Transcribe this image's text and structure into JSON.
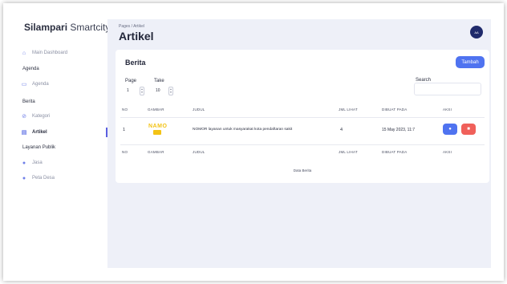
{
  "brand": {
    "bold": "Silampari",
    "light": " Smartcity"
  },
  "sidebar": {
    "dashboard": "Main Dashboard",
    "agenda_head": "Agenda",
    "agenda_item": "Agenda",
    "berita_head": "Berita",
    "kategori": "Kategori",
    "artikel": "Artikel",
    "layanan_head": "Layanan Publik",
    "jasa": "Jasa",
    "peta_desa": "Peta Desa"
  },
  "header": {
    "breadcrumb": "Pages / Artikel",
    "title": "Artikel",
    "avatar": "AA"
  },
  "card": {
    "title": "Berita",
    "add_label": "Tambah",
    "page_label": "Page",
    "page_value": "1",
    "take_label": "Take",
    "take_value": "10",
    "search_label": "Search",
    "search_value": ""
  },
  "table": {
    "headers": [
      "NO",
      "GAMBAR",
      "JUDUL",
      "JML LIHAT",
      "DIBUAT PADA",
      "AKSI"
    ],
    "rows": [
      {
        "no": "1",
        "thumb_text": "NAMO",
        "judul": "NOMOR layanan untuk masyarakat kota pendaftaran sakit",
        "jml_lihat": "4",
        "dibuat": "15 May 2023, 11:7"
      }
    ],
    "footer": "Data Berita"
  },
  "colors": {
    "accent": "#4f73f0",
    "danger": "#f0605a",
    "sidebar_active": "#5b5fe0"
  }
}
